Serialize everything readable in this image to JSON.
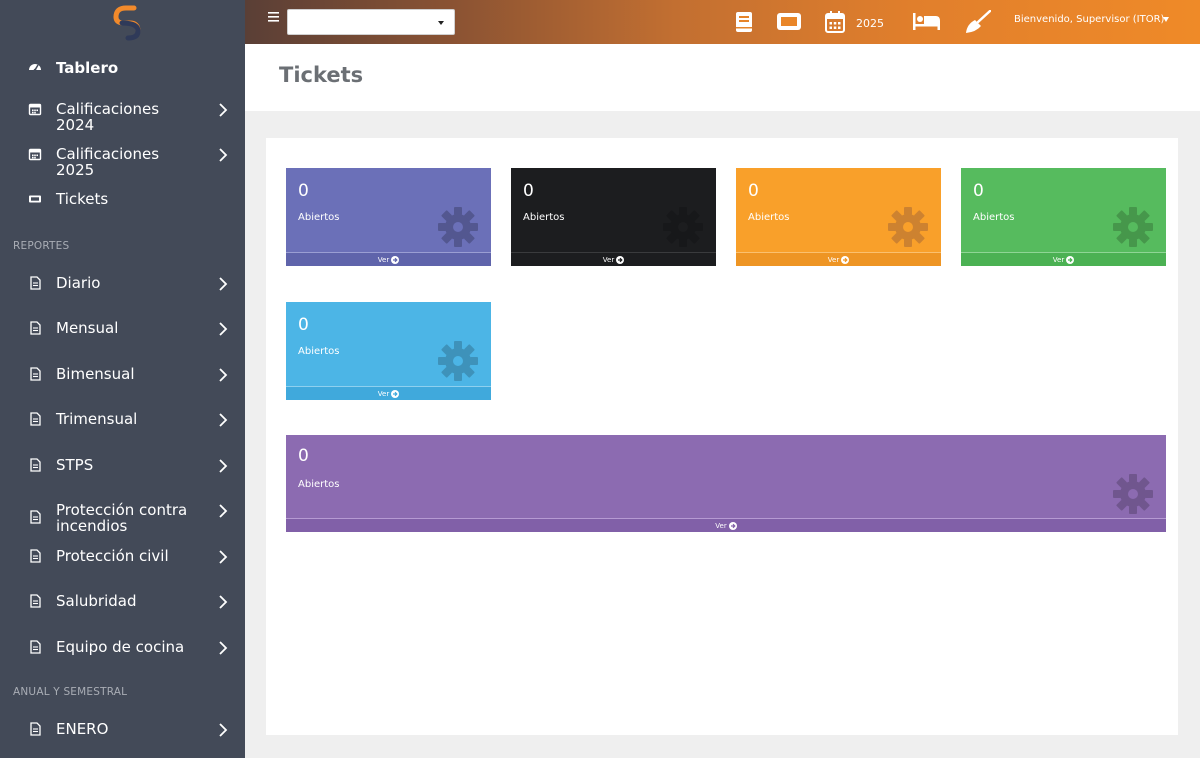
{
  "app": {
    "colors": {
      "sidebar_bg": "#434a58",
      "brand_orange": "#ef8a28",
      "card_indigo": "#6b70b8",
      "card_black": "#1c1d1f",
      "card_orange": "#f9a02a",
      "card_green": "#56bb5e",
      "card_blue": "#4cb5e6",
      "card_purple": "#8c6bb1"
    }
  },
  "sidebar": {
    "items": [
      {
        "label": "Tablero",
        "icon": "dashboard-icon"
      },
      {
        "label": "Calificaciones 2024",
        "icon": "calendar-icon"
      },
      {
        "label": "Calificaciones 2025",
        "icon": "calendar-icon"
      },
      {
        "label": "Tickets",
        "icon": "ticket-icon"
      },
      {
        "label": "Diario",
        "icon": "document-icon"
      },
      {
        "label": "Mensual",
        "icon": "document-icon"
      },
      {
        "label": "Bimensual",
        "icon": "document-icon"
      },
      {
        "label": "Trimensual",
        "icon": "document-icon"
      },
      {
        "label": "STPS",
        "icon": "document-icon"
      },
      {
        "label": "Protección contra incendios",
        "icon": "document-icon"
      },
      {
        "label": "Protección civil",
        "icon": "document-icon"
      },
      {
        "label": "Salubridad",
        "icon": "document-icon"
      },
      {
        "label": "Equipo de cocina",
        "icon": "document-icon"
      },
      {
        "label": "ENERO",
        "icon": "document-icon"
      }
    ],
    "sections": {
      "reportes": "REPORTES",
      "anual": "ANUAL Y SEMESTRAL"
    }
  },
  "topbar": {
    "select_value": "",
    "year": "2025",
    "welcome": "Bienvenido, Supervisor (ITOR)",
    "icons": [
      "book-icon",
      "ticket-icon",
      "calendar-icon",
      "bed-icon",
      "broom-icon"
    ]
  },
  "page": {
    "title": "Tickets"
  },
  "cards": [
    {
      "count": "0",
      "status": "Abiertos",
      "footer": "Ver",
      "color": "#6b70b8"
    },
    {
      "count": "0",
      "status": "Abiertos",
      "footer": "Ver",
      "color": "#1c1d1f"
    },
    {
      "count": "0",
      "status": "Abiertos",
      "footer": "Ver",
      "color": "#f9a02a"
    },
    {
      "count": "0",
      "status": "Abiertos",
      "footer": "Ver",
      "color": "#56bb5e"
    },
    {
      "count": "0",
      "status": "Abiertos",
      "footer": "Ver",
      "color": "#4cb5e6"
    },
    {
      "count": "0",
      "status": "Abiertos",
      "footer": "Ver",
      "color": "#8c6bb1"
    }
  ]
}
